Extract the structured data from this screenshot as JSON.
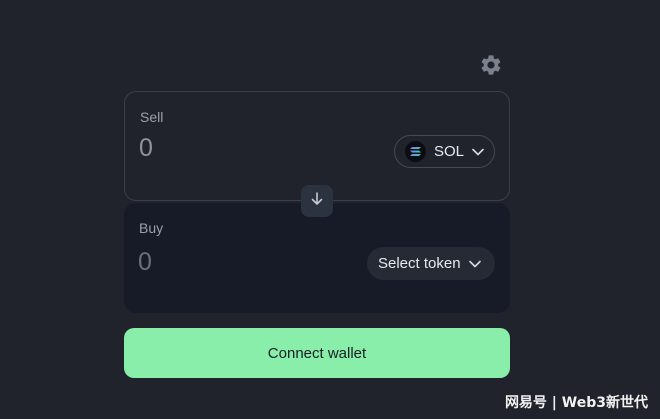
{
  "sell": {
    "label": "Sell",
    "amount": "0",
    "token": {
      "symbol": "SOL",
      "icon": "solana-logo-icon"
    }
  },
  "buy": {
    "label": "Buy",
    "amount": "0",
    "token_button_label": "Select token"
  },
  "connect_button_label": "Connect wallet",
  "watermark": "网易号 | Web3新世代",
  "colors": {
    "background": "#21232c",
    "buy_card": "#161b27",
    "accent_green": "#88eea9",
    "gear": "#7b818c"
  }
}
